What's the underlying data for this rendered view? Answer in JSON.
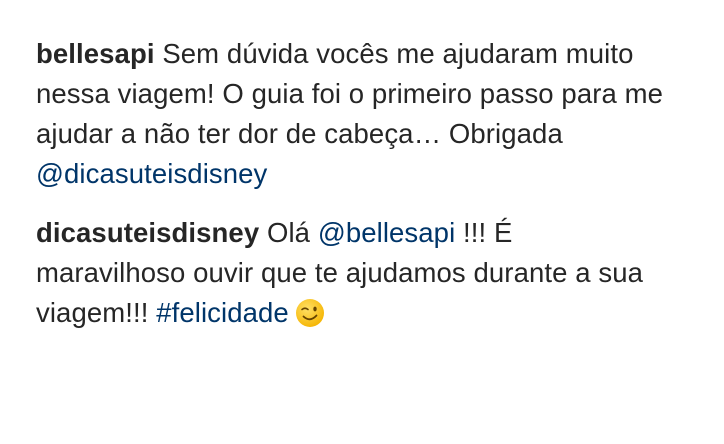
{
  "comments": [
    {
      "username": "bellesapi",
      "text": " Sem dúvida vocês me ajudaram muito nessa viagem! O guia foi o primeiro passo para me ajudar a não ter dor de cabeça… Obrigada ",
      "mention": "@dicasuteisdisney"
    },
    {
      "username": "dicasuteisdisney",
      "text_before": " Olá ",
      "mention": "@bellesapi",
      "text_middle": " !!! É maravilhoso ouvir que te ajudamos durante a sua viagem!!! ",
      "hashtag": "#felicidade",
      "emoji_icon": "winking-face-emoji"
    }
  ],
  "colors": {
    "text": "#262626",
    "link": "#003569",
    "emoji_face": "#FFCC33",
    "emoji_features": "#664400"
  }
}
